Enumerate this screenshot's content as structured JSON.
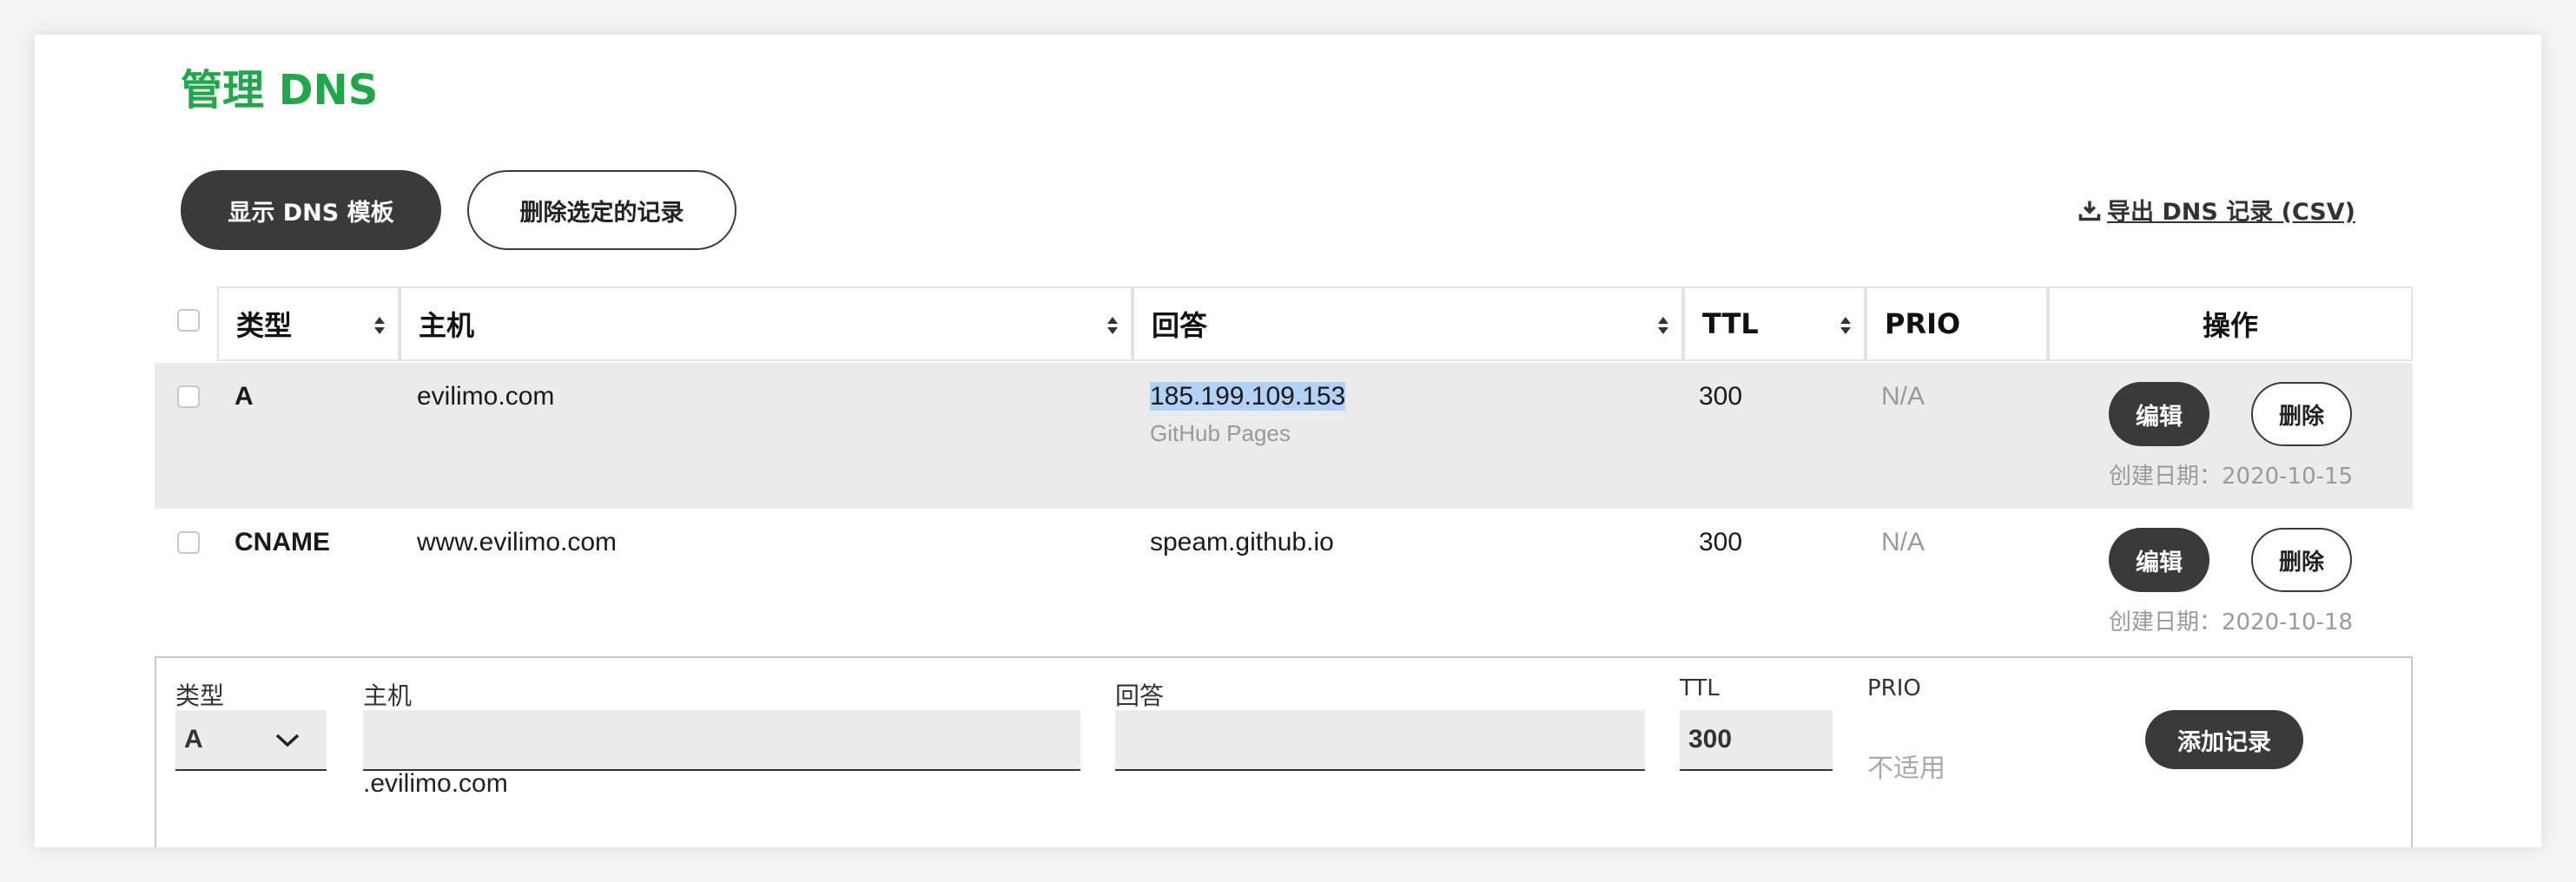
{
  "title": "管理 DNS",
  "toolbar": {
    "show_template_label": "显示 DNS 模板",
    "delete_selected_label": "删除选定的记录",
    "export_label": "导出 DNS 记录 (CSV)"
  },
  "table": {
    "headers": {
      "type": "类型",
      "host": "主机",
      "answer": "回答",
      "ttl": "TTL",
      "prio": "PRIO",
      "actions": "操作"
    },
    "rows": [
      {
        "type": "A",
        "host": "evilimo.com",
        "answer": "185.199.109.153",
        "answer_note": "GitHub Pages",
        "ttl": "300",
        "prio": "N/A",
        "edit_label": "编辑",
        "delete_label": "删除",
        "created": "创建日期：2020-10-15"
      },
      {
        "type": "CNAME",
        "host": "www.evilimo.com",
        "answer": "speam.github.io",
        "ttl": "300",
        "prio": "N/A",
        "edit_label": "编辑",
        "delete_label": "删除",
        "created": "创建日期：2020-10-18"
      }
    ]
  },
  "add_form": {
    "type_label": "类型",
    "type_value": "A",
    "host_label": "主机",
    "host_value": "",
    "host_suffix": ".evilimo.com",
    "answer_label": "回答",
    "answer_value": "",
    "ttl_label": "TTL",
    "ttl_value": "300",
    "prio_label": "PRIO",
    "prio_value": "不适用",
    "add_button_label": "添加记录"
  },
  "colors": {
    "accent_green": "#1fa84a",
    "button_dark": "#3a3a3a",
    "selection_highlight": "#b3d0f5"
  }
}
